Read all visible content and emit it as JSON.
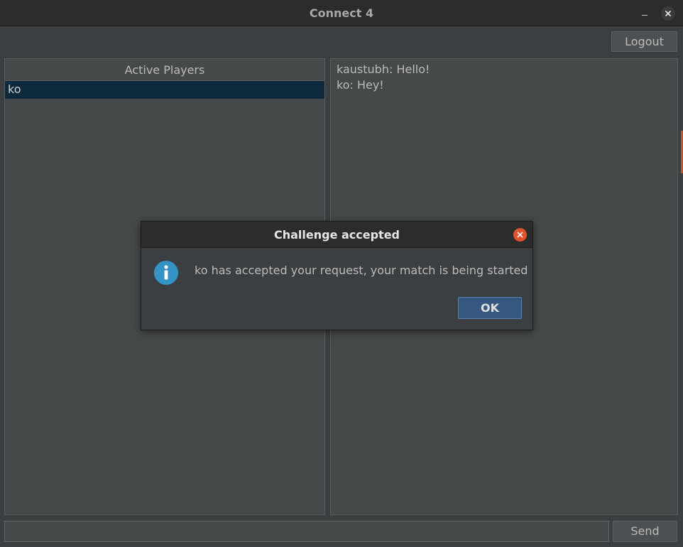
{
  "window": {
    "title": "Connect 4"
  },
  "toolbar": {
    "logout_label": "Logout"
  },
  "players": {
    "header": "Active Players",
    "items": [
      "ko"
    ]
  },
  "chat": {
    "messages": [
      "kaustubh: Hello!",
      "ko: Hey!"
    ]
  },
  "composer": {
    "input_value": "",
    "send_label": "Send"
  },
  "dialog": {
    "title": "Challenge accepted",
    "message": "ko has accepted your request, your match is being started",
    "ok_label": "OK",
    "icon": "info-icon"
  },
  "colors": {
    "background": "#3c3f41",
    "titlebar": "#2c2c2c",
    "selection": "#0d293e",
    "primary_button": "#365880",
    "close_accent": "#e0542d",
    "info_icon": "#3592c4"
  }
}
